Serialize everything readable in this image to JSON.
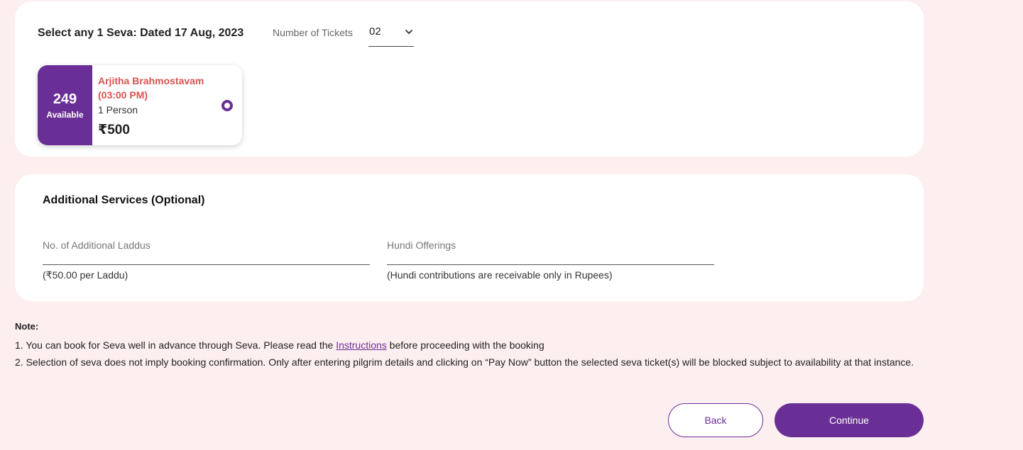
{
  "colors": {
    "page_background": "#fdeef0",
    "card_background": "#ffffff",
    "accent_purple": "#6a2f96",
    "seva_name_red": "#d9534f"
  },
  "seva_section": {
    "heading": "Select any 1 Seva: Dated 17 Aug, 2023",
    "tickets_label": "Number of Tickets",
    "tickets_selected": "02",
    "dropdown_icon": "chevron-down-icon",
    "seva_option": {
      "available_count": "249",
      "available_label": "Available",
      "name": "Arjitha Brahmostavam",
      "time": "(03:00 PM)",
      "persons": "1 Person",
      "price": "₹500",
      "selected": true
    }
  },
  "additional_services": {
    "heading": "Additional Services (Optional)",
    "laddus": {
      "placeholder": "No. of Additional Laddus",
      "value": "",
      "help": "(₹50.00 per Laddu)"
    },
    "hundi": {
      "placeholder": "Hundi Offerings",
      "value": "",
      "help": "(Hundi contributions are receivable only in Rupees)"
    }
  },
  "note": {
    "title": "Note:",
    "line1_before": "1. You can book for Seva well in advance through Seva. Please read the ",
    "line1_link": "Instructions",
    "line1_after": " before proceeding with the booking",
    "line2": "2. Selection of seva does not imply booking confirmation. Only after entering pilgrim details and clicking on “Pay Now” button the selected seva ticket(s) will be blocked subject to availability at that instance."
  },
  "actions": {
    "back_label": "Back",
    "continue_label": "Continue"
  }
}
